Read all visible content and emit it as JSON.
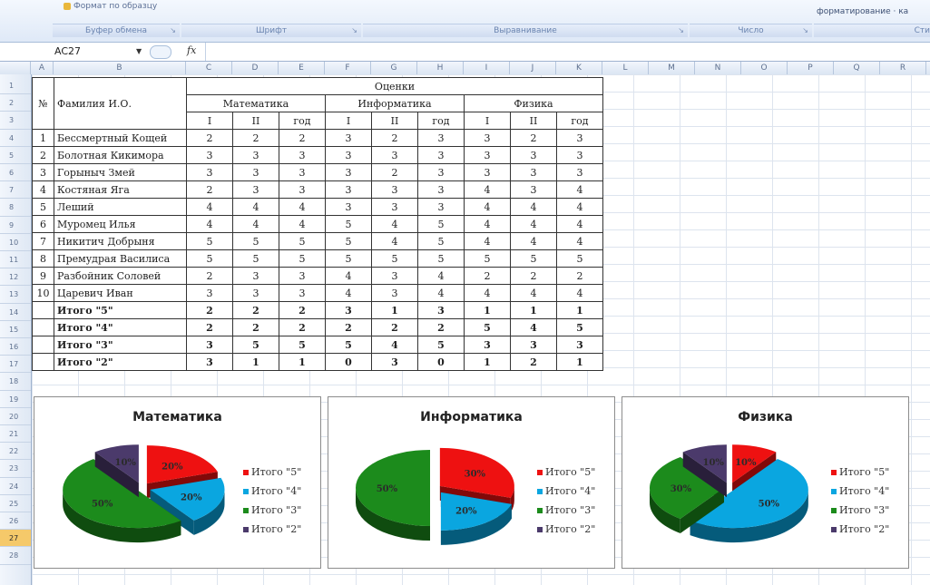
{
  "ribbon": {
    "copy_format": "Формат по образцу",
    "groups": [
      {
        "label": "Буфер обмена"
      },
      {
        "label": "Шрифт"
      },
      {
        "label": "Выравнивание"
      },
      {
        "label": "Число"
      },
      {
        "label": "Сти"
      }
    ],
    "right_text": "форматирование ·  ка"
  },
  "formula_bar": {
    "cell_ref": "AC27",
    "fx": "fx",
    "formula": ""
  },
  "columns": [
    "A",
    "B",
    "C",
    "D",
    "E",
    "F",
    "G",
    "H",
    "I",
    "J",
    "K",
    "L",
    "M",
    "N",
    "O",
    "P",
    "Q",
    "R"
  ],
  "rows": [
    "1",
    "2",
    "3",
    "4",
    "5",
    "6",
    "7",
    "8",
    "9",
    "10",
    "11",
    "12",
    "13",
    "14",
    "15",
    "16",
    "17",
    "18",
    "19",
    "20",
    "21",
    "22",
    "23",
    "24",
    "25",
    "26",
    "27",
    "28"
  ],
  "selected_row": "27",
  "table": {
    "num_header": "№",
    "name_header": "Фамилия И.О.",
    "grades_header": "Оценки",
    "subjects": [
      "Математика",
      "Информатика",
      "Физика"
    ],
    "sub_headers": [
      "I",
      "II",
      "год"
    ],
    "students": [
      {
        "n": "1",
        "name": "Бессмертный Кощей",
        "g": [
          "2",
          "2",
          "2",
          "3",
          "2",
          "3",
          "3",
          "2",
          "3"
        ]
      },
      {
        "n": "2",
        "name": "Болотная Кикимора",
        "g": [
          "3",
          "3",
          "3",
          "3",
          "3",
          "3",
          "3",
          "3",
          "3"
        ]
      },
      {
        "n": "3",
        "name": "Горыныч Змей",
        "g": [
          "3",
          "3",
          "3",
          "3",
          "2",
          "3",
          "3",
          "3",
          "3"
        ]
      },
      {
        "n": "4",
        "name": "Костяная Яга",
        "g": [
          "2",
          "3",
          "3",
          "3",
          "3",
          "3",
          "4",
          "3",
          "4"
        ]
      },
      {
        "n": "5",
        "name": "Леший",
        "g": [
          "4",
          "4",
          "4",
          "3",
          "3",
          "3",
          "4",
          "4",
          "4"
        ]
      },
      {
        "n": "6",
        "name": "Муромец Илья",
        "g": [
          "4",
          "4",
          "4",
          "5",
          "4",
          "5",
          "4",
          "4",
          "4"
        ]
      },
      {
        "n": "7",
        "name": "Никитич Добрыня",
        "g": [
          "5",
          "5",
          "5",
          "5",
          "4",
          "5",
          "4",
          "4",
          "4"
        ]
      },
      {
        "n": "8",
        "name": "Премудрая Василиса",
        "g": [
          "5",
          "5",
          "5",
          "5",
          "5",
          "5",
          "5",
          "5",
          "5"
        ]
      },
      {
        "n": "9",
        "name": "Разбойник Соловей",
        "g": [
          "2",
          "3",
          "3",
          "4",
          "3",
          "4",
          "2",
          "2",
          "2"
        ]
      },
      {
        "n": "10",
        "name": "Царевич Иван",
        "g": [
          "3",
          "3",
          "3",
          "4",
          "3",
          "4",
          "4",
          "4",
          "4"
        ]
      }
    ],
    "totals": [
      {
        "label": "Итого \"5\"",
        "g": [
          "2",
          "2",
          "2",
          "3",
          "1",
          "3",
          "1",
          "1",
          "1"
        ]
      },
      {
        "label": "Итого \"4\"",
        "g": [
          "2",
          "2",
          "2",
          "2",
          "2",
          "2",
          "5",
          "4",
          "5"
        ]
      },
      {
        "label": "Итого \"3\"",
        "g": [
          "3",
          "5",
          "5",
          "5",
          "4",
          "5",
          "3",
          "3",
          "3"
        ]
      },
      {
        "label": "Итого \"2\"",
        "g": [
          "3",
          "1",
          "1",
          "0",
          "3",
          "0",
          "1",
          "2",
          "1"
        ]
      }
    ]
  },
  "colors": {
    "c5": "#ee1111",
    "c4": "#0aa6e0",
    "c3": "#1c8b1c",
    "c2": "#4b3a6b"
  },
  "chart_data": [
    {
      "type": "pie",
      "title": "Математика",
      "categories": [
        "Итого \"5\"",
        "Итого \"4\"",
        "Итого \"3\"",
        "Итого \"2\""
      ],
      "values": [
        20,
        20,
        50,
        10
      ],
      "labels": [
        "20%",
        "20%",
        "50%",
        "10%"
      ],
      "legend": "right"
    },
    {
      "type": "pie",
      "title": "Информатика",
      "categories": [
        "Итого \"5\"",
        "Итого \"4\"",
        "Итого \"3\"",
        "Итого \"2\""
      ],
      "values": [
        30,
        20,
        50,
        0
      ],
      "labels": [
        "30%",
        "20%",
        "50%",
        ""
      ],
      "legend": "right"
    },
    {
      "type": "pie",
      "title": "Физика",
      "categories": [
        "Итого \"5\"",
        "Итого \"4\"",
        "Итого \"3\"",
        "Итого \"2\""
      ],
      "values": [
        10,
        50,
        30,
        10
      ],
      "labels": [
        "10%",
        "50%",
        "30%",
        "10%"
      ],
      "legend": "right"
    }
  ]
}
